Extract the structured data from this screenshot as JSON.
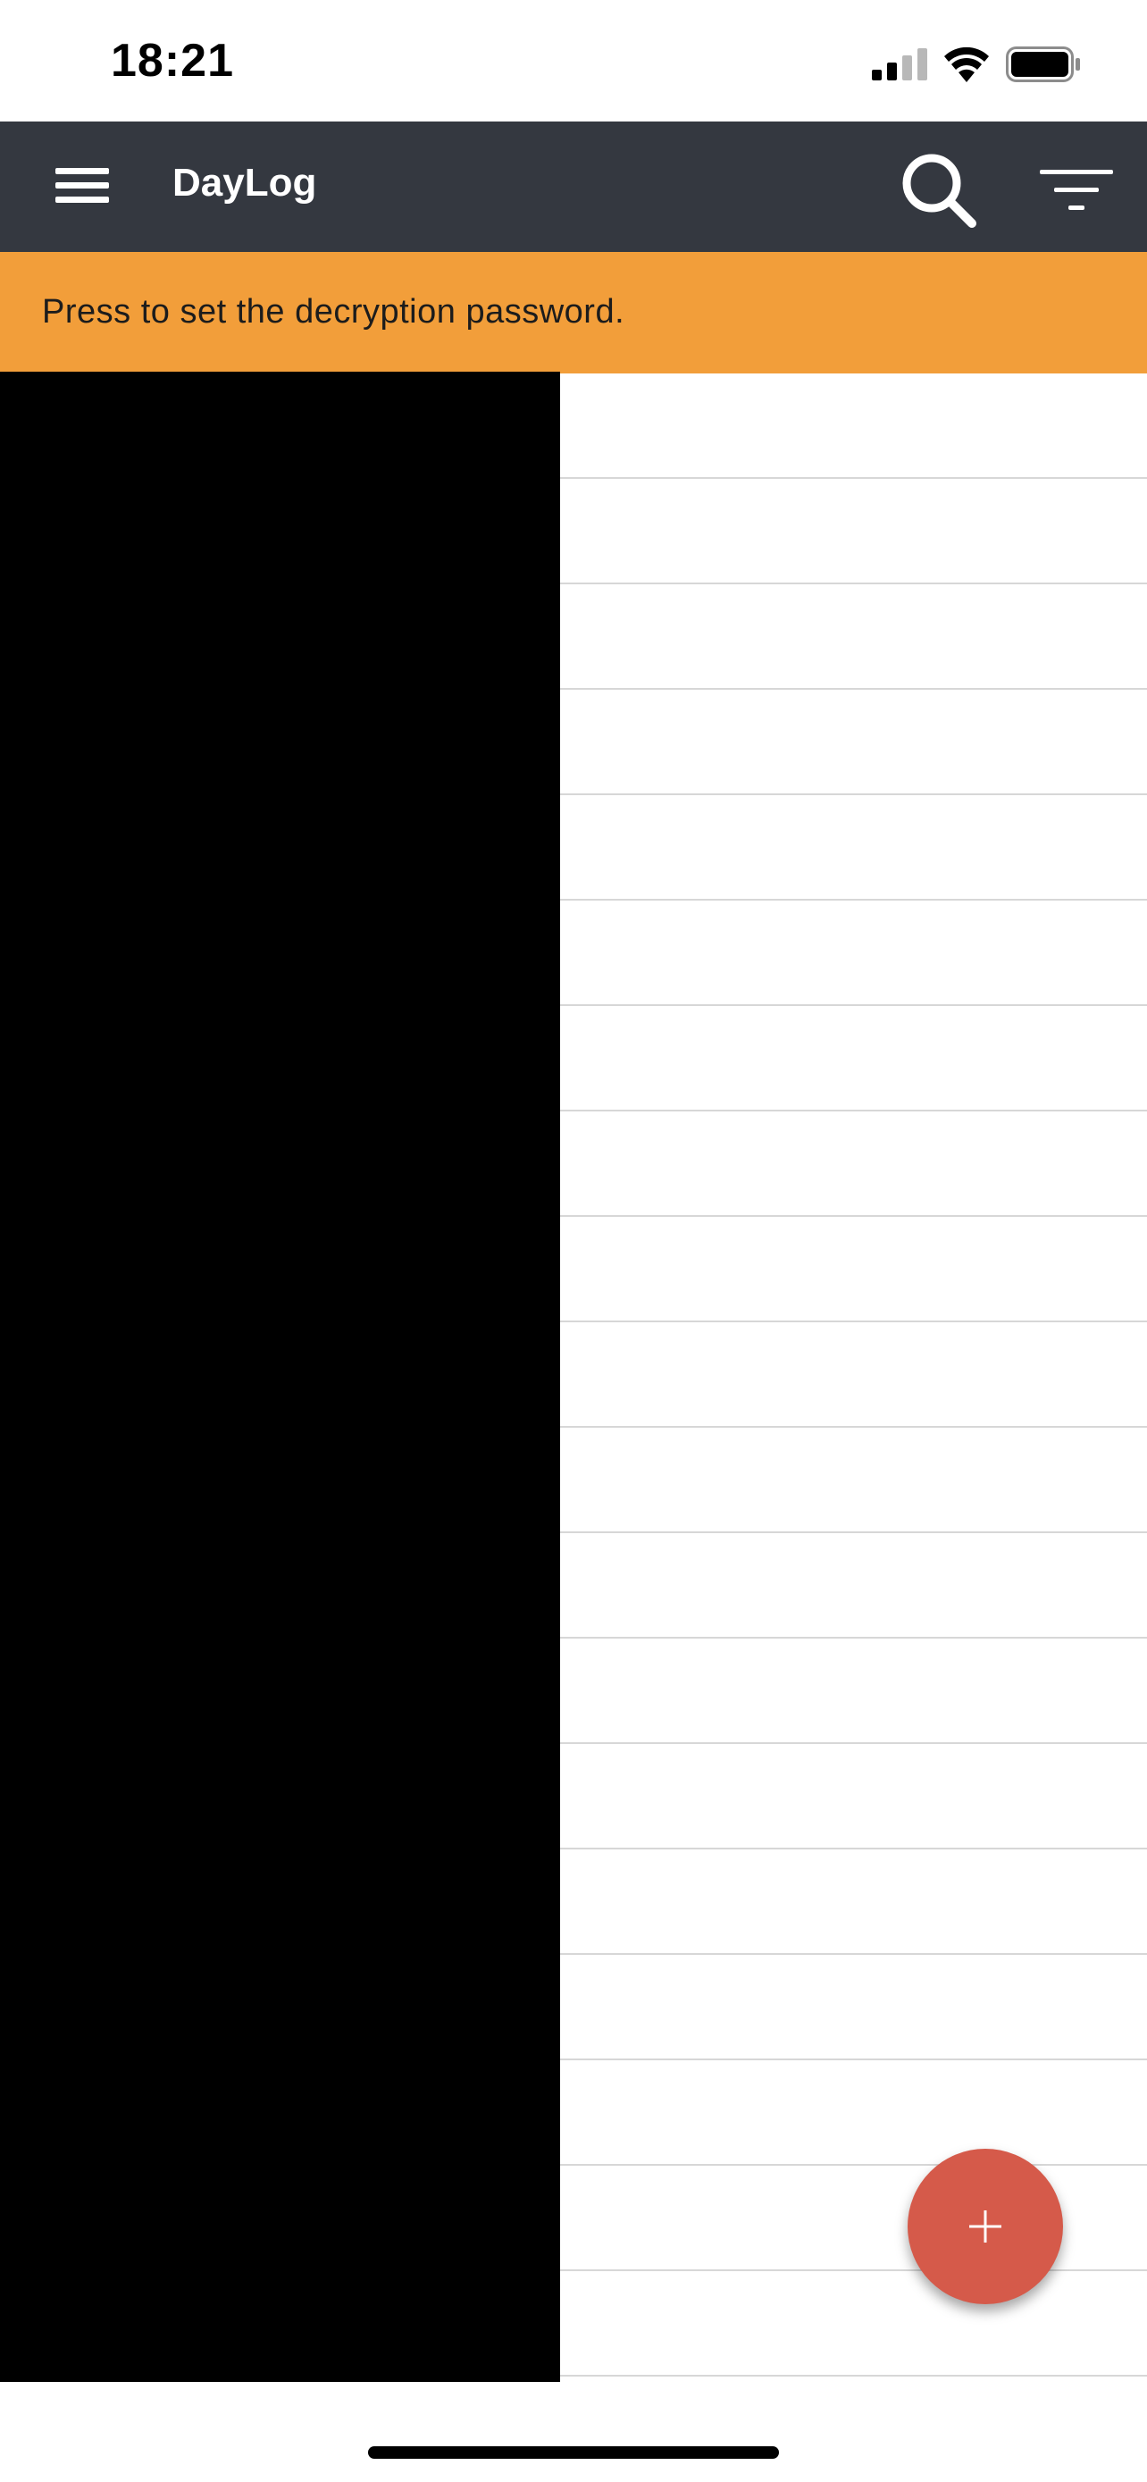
{
  "status_bar": {
    "time": "18:21",
    "icons": [
      "signal-icon",
      "wifi-icon",
      "battery-icon"
    ]
  },
  "app_bar": {
    "title": "DayLog",
    "icons": [
      "menu-icon",
      "search-icon",
      "filter-icon"
    ],
    "background": "#343840"
  },
  "banner": {
    "text": "Press to set the decryption password.",
    "background": "#f29e3a"
  },
  "list": {
    "row_count": 19
  },
  "fab": {
    "icon": "plus-icon",
    "color": "#d55a4a"
  }
}
